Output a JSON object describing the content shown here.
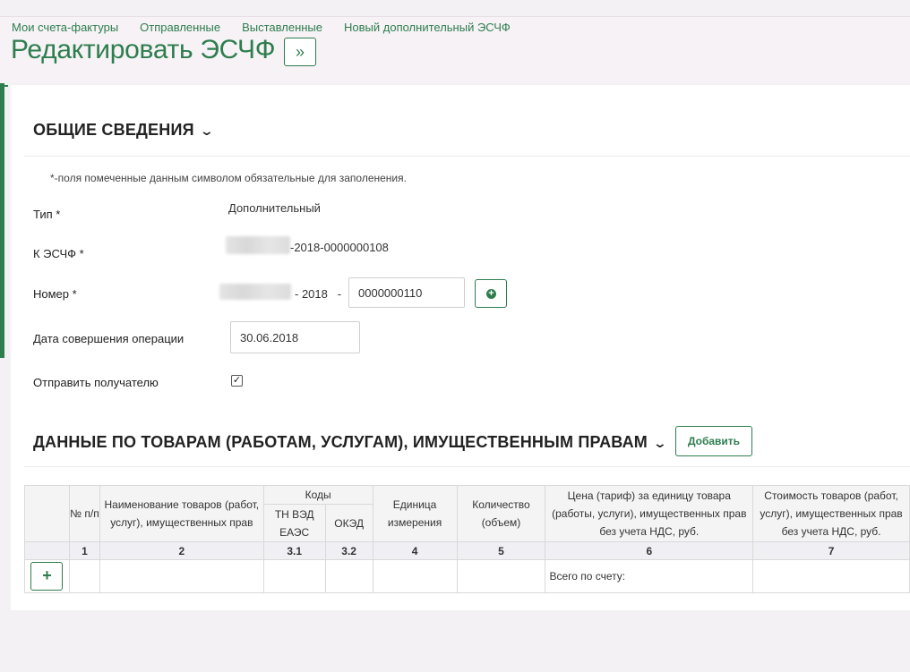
{
  "nav": {
    "items": [
      "Мои счета-фактуры",
      "Отправленные",
      "Выставленные",
      "Новый дополнительный ЭСЧФ"
    ]
  },
  "page": {
    "title": "Редактировать ЭСЧФ",
    "expand_label": "»"
  },
  "general": {
    "heading": "ОБЩИЕ СВЕДЕНИЯ",
    "chevron": "⌄",
    "note": "*-поля помеченные данным символом обязательные для заполенения.",
    "type_label": "Тип *",
    "type_value": "Дополнительный",
    "k_label": "К ЭСЧФ *",
    "k_value_suffix": "-2018-0000000108",
    "number_label": "Номер *",
    "number_mid": "- 2018   -",
    "number_value": "0000000110",
    "date_label": "Дата совершения операции",
    "date_value": "30.06.2018",
    "send_label": "Отправить получателю",
    "send_checked": "✓"
  },
  "goods": {
    "heading": "ДАННЫЕ ПО ТОВАРАМ (РАБОТАМ, УСЛУГАМ), ИМУЩЕСТВЕННЫМ ПРАВАМ",
    "chevron": "⌄",
    "add_label": "Добавить",
    "columns": {
      "num": "№ п/п",
      "name": "Наименование товаров (работ, услуг), имущественных прав",
      "codes": "Коды",
      "tnved": "ТН ВЭД ЕАЭС",
      "oked": "ОКЭД",
      "unit": "Единица измерения",
      "qty": "Количество (объем)",
      "price": "Цена (тариф) за единицу товара (работы, услуги), имущественных прав без учета НДС, руб.",
      "cost": "Стоимость товаров (работ, услуг), имущественных прав без учета НДС, руб."
    },
    "column_numbers": [
      "1",
      "2",
      "3.1",
      "3.2",
      "4",
      "5",
      "6",
      "7"
    ],
    "total_label": "Всего по счету:",
    "row_add_label": "+"
  },
  "colors": {
    "accent": "#2e7d4f",
    "background": "#f3f1f3"
  }
}
